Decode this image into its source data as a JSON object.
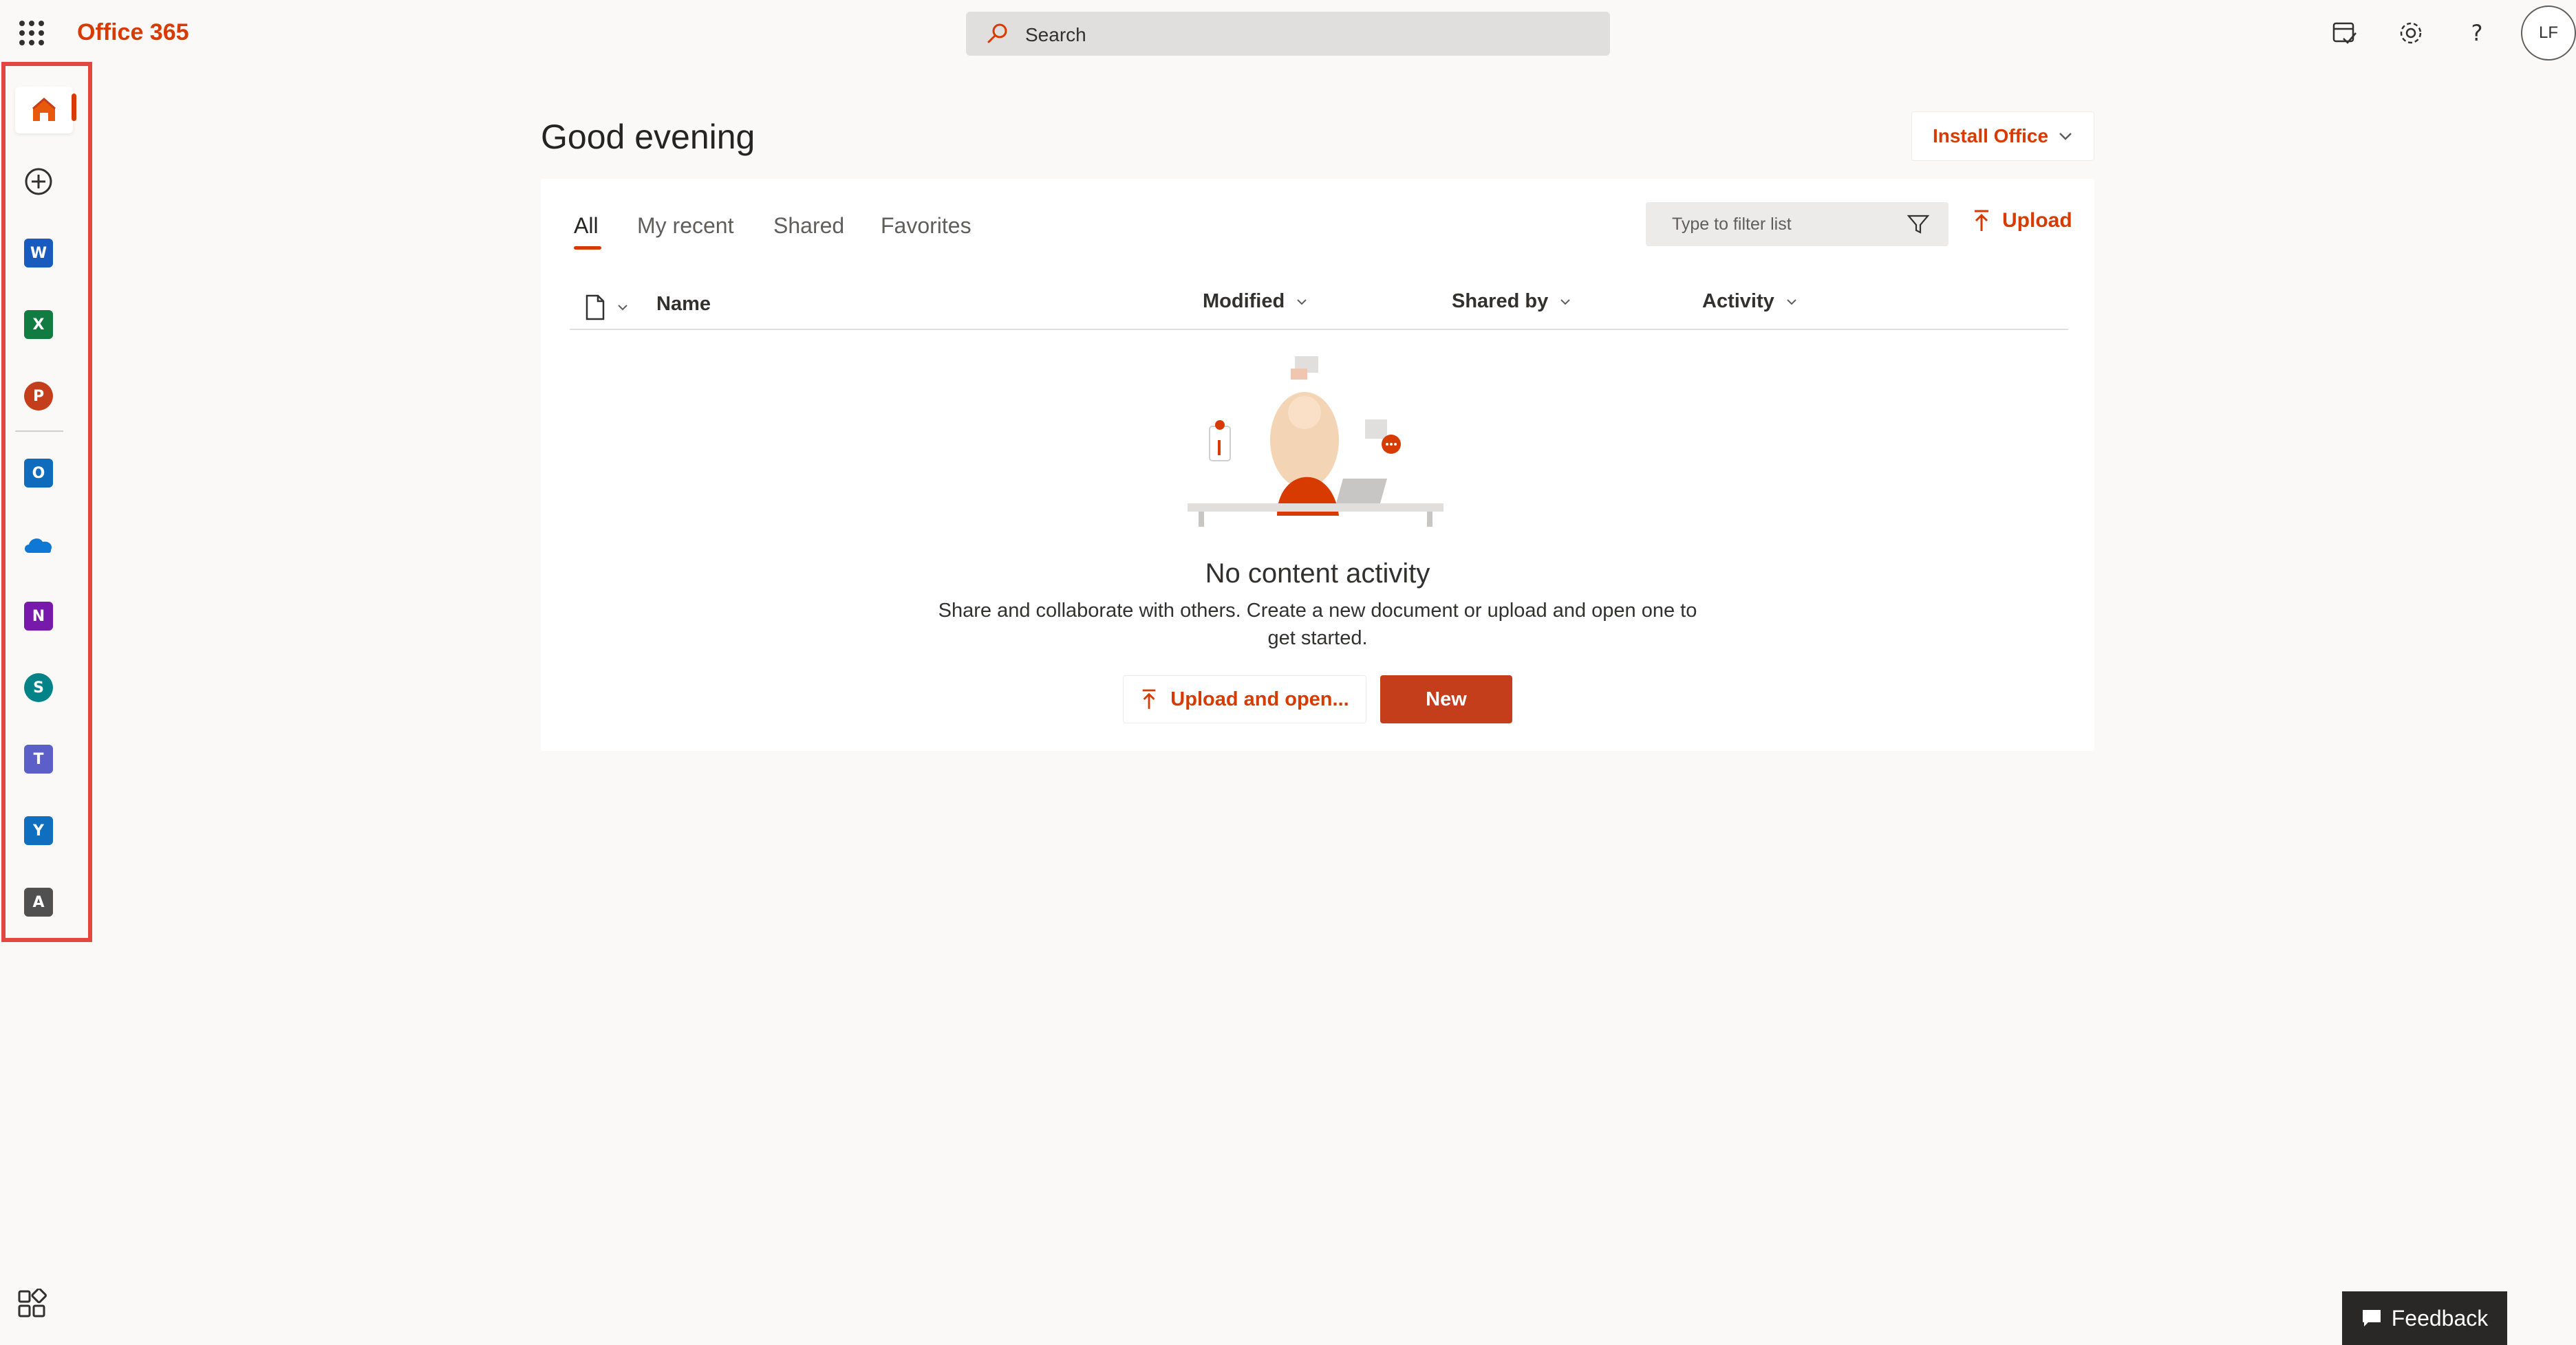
{
  "header": {
    "brand": "Office 365",
    "search_placeholder": "Search",
    "avatar_initials": "LF"
  },
  "rail": {
    "items": [
      {
        "name": "home",
        "letter": ""
      },
      {
        "name": "create",
        "letter": ""
      },
      {
        "name": "word",
        "letter": "W",
        "color": "#185abd"
      },
      {
        "name": "excel",
        "letter": "X",
        "color": "#107c41"
      },
      {
        "name": "powerpoint",
        "letter": "P",
        "color": "#c43e1c"
      },
      {
        "name": "outlook",
        "letter": "O",
        "color": "#0f6cbd"
      },
      {
        "name": "onedrive",
        "letter": ""
      },
      {
        "name": "onenote",
        "letter": "N",
        "color": "#7719aa"
      },
      {
        "name": "sharepoint",
        "letter": "S",
        "color": "#038387"
      },
      {
        "name": "teams",
        "letter": "T",
        "color": "#5b5fc7"
      },
      {
        "name": "yammer",
        "letter": "Y",
        "color": "#106ebe"
      },
      {
        "name": "admin",
        "letter": "A",
        "color": "#505050"
      }
    ]
  },
  "main": {
    "greeting": "Good evening",
    "install_label": "Install Office",
    "tabs": [
      "All",
      "My recent",
      "Shared",
      "Favorites"
    ],
    "filter_placeholder": "Type to filter list",
    "upload_label": "Upload",
    "columns": [
      "Name",
      "Modified",
      "Shared by",
      "Activity"
    ],
    "empty_title": "No content activity",
    "empty_desc": "Share and collaborate with others. Create a new document or upload and open one to get started.",
    "upload_open_label": "Upload and open...",
    "new_label": "New"
  },
  "feedback_label": "Feedback",
  "colors": {
    "accent": "#d83b01",
    "new_button": "#c43e1c",
    "highlight_border": "#e3473f"
  }
}
